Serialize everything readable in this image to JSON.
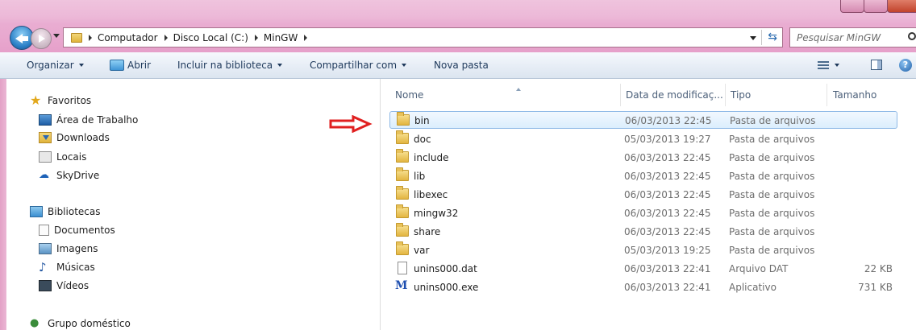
{
  "address": {
    "crumbs": [
      "Computador",
      "Disco Local (C:)",
      "MinGW"
    ],
    "search_placeholder": "Pesquisar MinGW"
  },
  "toolbar": {
    "organize": "Organizar",
    "open": "Abrir",
    "include_library": "Incluir na biblioteca",
    "share": "Compartilhar com",
    "new_folder": "Nova pasta"
  },
  "navpane": {
    "favorites": "Favoritos",
    "desktop": "Área de Trabalho",
    "downloads": "Downloads",
    "places": "Locais",
    "skydrive": "SkyDrive",
    "libraries": "Bibliotecas",
    "documents": "Documentos",
    "images": "Imagens",
    "music": "Músicas",
    "videos": "Vídeos",
    "homegroup": "Grupo doméstico"
  },
  "columns": {
    "name": "Nome",
    "date": "Data de modificaç...",
    "type": "Tipo",
    "size": "Tamanho"
  },
  "files": [
    {
      "name": "bin",
      "date": "06/03/2013 22:45",
      "type": "Pasta de arquivos",
      "size": "",
      "icon": "folder-icon",
      "selected": true
    },
    {
      "name": "doc",
      "date": "05/03/2013 19:27",
      "type": "Pasta de arquivos",
      "size": "",
      "icon": "folder-icon"
    },
    {
      "name": "include",
      "date": "06/03/2013 22:45",
      "type": "Pasta de arquivos",
      "size": "",
      "icon": "folder-icon"
    },
    {
      "name": "lib",
      "date": "06/03/2013 22:45",
      "type": "Pasta de arquivos",
      "size": "",
      "icon": "folder-icon"
    },
    {
      "name": "libexec",
      "date": "06/03/2013 22:45",
      "type": "Pasta de arquivos",
      "size": "",
      "icon": "folder-icon"
    },
    {
      "name": "mingw32",
      "date": "06/03/2013 22:45",
      "type": "Pasta de arquivos",
      "size": "",
      "icon": "folder-icon"
    },
    {
      "name": "share",
      "date": "06/03/2013 22:45",
      "type": "Pasta de arquivos",
      "size": "",
      "icon": "folder-icon"
    },
    {
      "name": "var",
      "date": "05/03/2013 19:25",
      "type": "Pasta de arquivos",
      "size": "",
      "icon": "folder-icon"
    },
    {
      "name": "unins000.dat",
      "date": "06/03/2013 22:41",
      "type": "Arquivo DAT",
      "size": "22 KB",
      "icon": "file-icon"
    },
    {
      "name": "unins000.exe",
      "date": "06/03/2013 22:41",
      "type": "Aplicativo",
      "size": "731 KB",
      "icon": "app-icon"
    }
  ],
  "colors": {
    "chrome": "#e8a8cf",
    "selection": "#dbeefd",
    "arrow": "#e02020"
  }
}
